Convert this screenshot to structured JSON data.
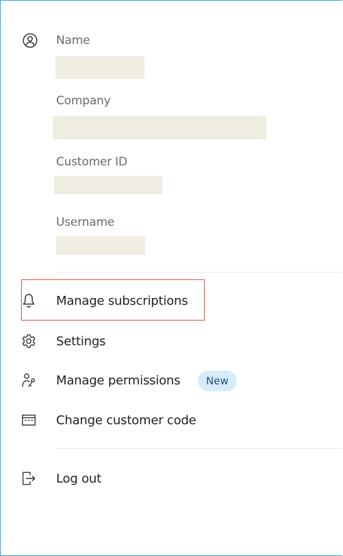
{
  "profile": {
    "fields": [
      {
        "label": "Name"
      },
      {
        "label": "Company"
      },
      {
        "label": "Customer ID"
      },
      {
        "label": "Username"
      }
    ]
  },
  "menu": {
    "items": [
      {
        "label": "Manage subscriptions",
        "icon": "bell-icon"
      },
      {
        "label": "Settings",
        "icon": "gear-icon"
      },
      {
        "label": "Manage permissions",
        "icon": "permissions-icon",
        "badge": "New"
      },
      {
        "label": "Change customer code",
        "icon": "card-icon"
      },
      {
        "label": "Log out",
        "icon": "logout-icon"
      }
    ]
  },
  "colors": {
    "panel_border": "#29a8e0",
    "highlight_border": "#e8523f",
    "badge_background": "#d6ecfa",
    "placeholder": "#efece2"
  }
}
